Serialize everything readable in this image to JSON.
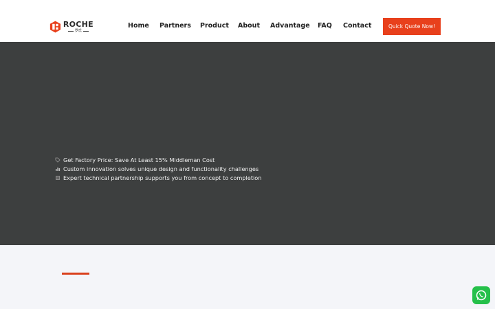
{
  "brand": {
    "name": "ROCHE",
    "sub": "罗氏",
    "accent": "#e8401c"
  },
  "nav": {
    "items": [
      "Home",
      "Partners",
      "Product",
      "About",
      "Advantage",
      "FAQ",
      "Contact"
    ]
  },
  "cta": {
    "label": "Quick Quote Now!"
  },
  "hero": {
    "background": "#3d3f3f",
    "features": [
      {
        "icon": "tag-icon",
        "text": "Get Factory Price: Save At Least 15% Middleman Cost"
      },
      {
        "icon": "bar-chart-icon",
        "text": "Custom innovation solves unique design and functionality challenges"
      },
      {
        "icon": "handshake-icon",
        "text": "Expert technical partnership supports you from concept to completion"
      }
    ]
  },
  "floating": {
    "whatsapp_icon": "whatsapp-icon"
  }
}
